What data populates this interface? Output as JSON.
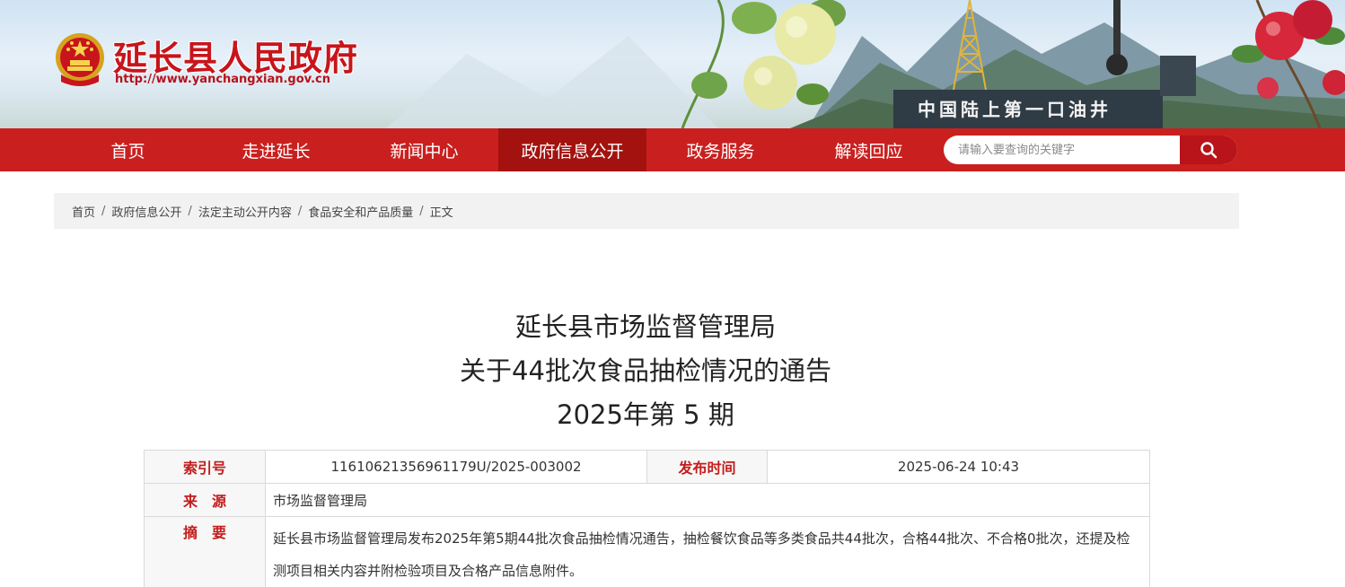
{
  "header": {
    "site_title": "延长县人民政府",
    "site_url": "http://www.yanchangxian.gov.cn",
    "monument_text": "中国陆上第一口油井",
    "brand_color": "#c9201f"
  },
  "nav": {
    "items": [
      {
        "label": "首页"
      },
      {
        "label": "走进延长"
      },
      {
        "label": "新闻中心"
      },
      {
        "label": "政府信息公开",
        "active": true
      },
      {
        "label": "政务服务"
      },
      {
        "label": "解读回应"
      }
    ],
    "search": {
      "placeholder": "请输入要查询的关键字",
      "icon": "search-icon"
    }
  },
  "breadcrumb": {
    "items": [
      "首页",
      "政府信息公开",
      "法定主动公开内容",
      "食品安全和产品质量",
      "正文"
    ],
    "separator": "/"
  },
  "article": {
    "title_lines": [
      "延长县市场监督管理局",
      "关于44批次食品抽检情况的通告",
      "2025年第 5 期"
    ]
  },
  "meta": {
    "index_label": "索引号",
    "index_value": "11610621356961179U/2025-003002",
    "publish_label": "发布时间",
    "publish_value": "2025-06-24 10:43",
    "source_label": "来　源",
    "source_value": "市场监督管理局",
    "summary_label": "摘　要",
    "summary_value": "延长县市场监督管理局发布2025年第5期44批次食品抽检情况通告，抽检餐饮食品等多类食品共44批次，合格44批次、不合格0批次，还提及检测项目相关内容并附检验项目及合格产品信息附件。",
    "label_color": "#c21d1d"
  }
}
